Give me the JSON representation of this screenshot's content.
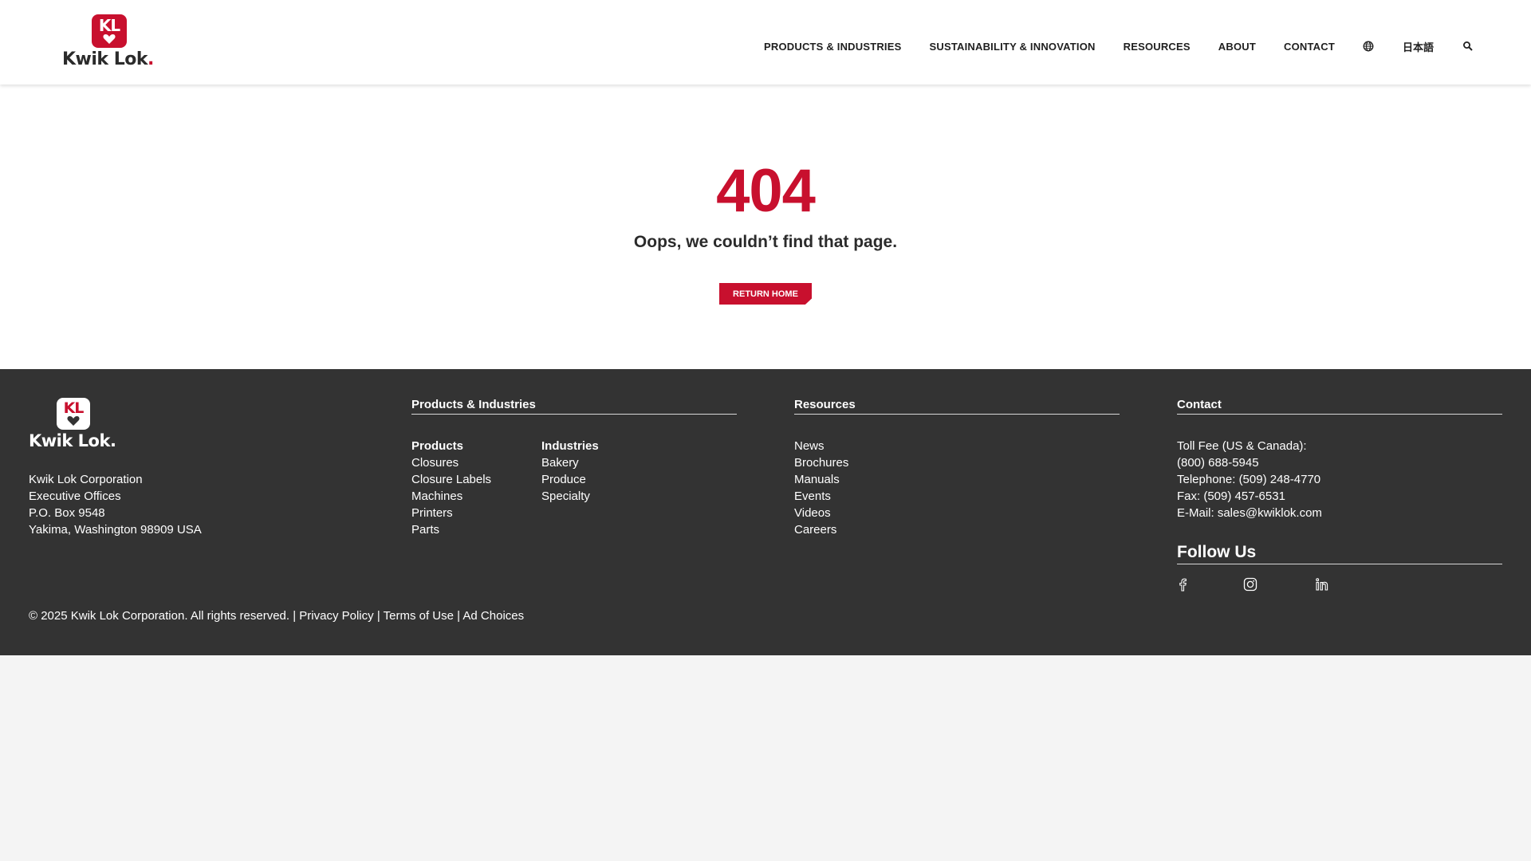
{
  "brand": {
    "badge_letters": "KL",
    "wordmark": "Kwik Lok",
    "primary_color": "#c8102e",
    "dark_color": "#333333"
  },
  "nav": {
    "items": [
      {
        "label": "PRODUCTS & INDUSTRIES"
      },
      {
        "label": "SUSTAINABILITY & INNOVATION"
      },
      {
        "label": "RESOURCES"
      },
      {
        "label": "ABOUT"
      },
      {
        "label": "CONTACT"
      }
    ],
    "globe_icon": "globe-icon",
    "language_label": "日本語",
    "search_icon": "search-icon"
  },
  "error": {
    "code": "404",
    "message": "Oops, we couldn’t find that page.",
    "button_label": "RETURN HOME"
  },
  "footer": {
    "address": [
      "Kwik Lok Corporation",
      "Executive Offices",
      "P.O. Box 9548",
      "Yakima, Washington 98909 USA"
    ],
    "products_industries": {
      "title": "Products & Industries",
      "products": {
        "title": "Products",
        "items": [
          "Closures",
          "Closure Labels",
          "Machines",
          "Printers",
          "Parts"
        ]
      },
      "industries": {
        "title": "Industries",
        "items": [
          "Bakery",
          "Produce",
          "Specialty"
        ]
      }
    },
    "resources": {
      "title": "Resources",
      "items": [
        "News",
        "Brochures",
        "Manuals",
        "Events",
        "Videos",
        "Careers"
      ]
    },
    "contact": {
      "title": "Contact",
      "lines": [
        "Toll Fee (US & Canada):",
        "(800) 688-5945",
        "Telephone: (509) 248-4770",
        "Fax: (509) 457-6531",
        "E-Mail: sales@kwiklok.com"
      ]
    },
    "follow": {
      "title": "Follow Us",
      "icons": [
        "facebook-icon",
        "instagram-icon",
        "linkedin-icon"
      ]
    },
    "copyright": "© 2025 Kwik Lok Corporation. All rights reserved. |",
    "legal_links": [
      "Privacy Policy",
      "Terms of Use",
      "Ad Choices"
    ],
    "separator": "|"
  }
}
